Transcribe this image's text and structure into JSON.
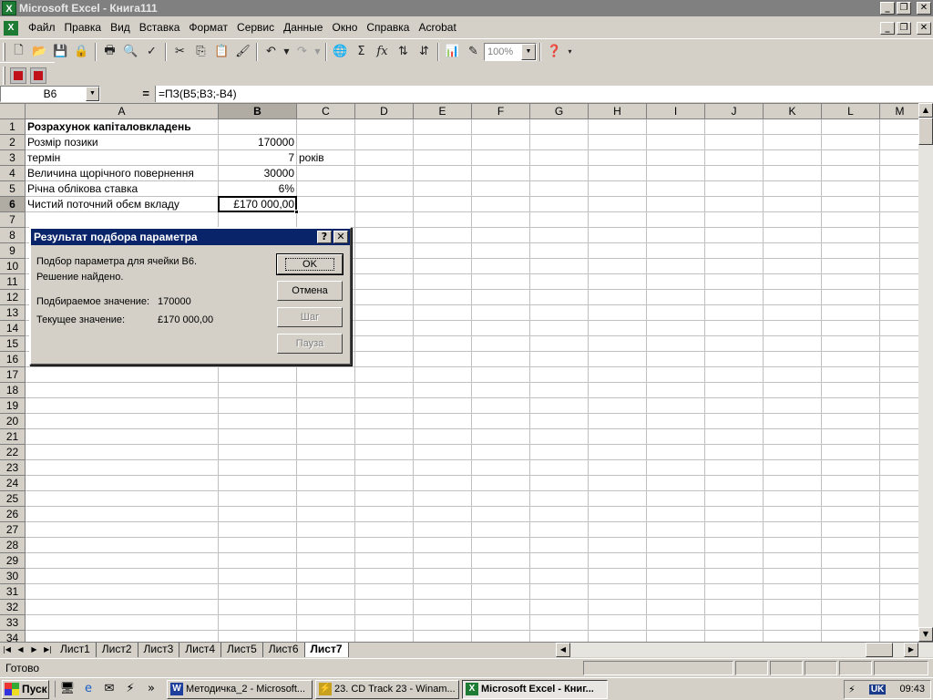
{
  "window": {
    "title": "Microsoft Excel - Книга111"
  },
  "menu": [
    "Файл",
    "Правка",
    "Вид",
    "Вставка",
    "Формат",
    "Сервис",
    "Данные",
    "Окно",
    "Справка",
    "Acrobat"
  ],
  "toolbar": {
    "zoom": "100%"
  },
  "formula_bar": {
    "name_box": "B6",
    "equals": "=",
    "formula": "=ПЗ(B5;B3;-B4)"
  },
  "columns": [
    "A",
    "B",
    "C",
    "D",
    "E",
    "F",
    "G",
    "H",
    "I",
    "J",
    "K",
    "L",
    "M"
  ],
  "rows": [
    "1",
    "2",
    "3",
    "4",
    "5",
    "6",
    "7",
    "8",
    "9",
    "10",
    "11",
    "12",
    "13",
    "14",
    "15",
    "16",
    "17",
    "18",
    "19",
    "20",
    "21",
    "22",
    "23",
    "24",
    "25",
    "26",
    "27",
    "28",
    "29",
    "30",
    "31",
    "32",
    "33",
    "34"
  ],
  "cells": {
    "a1": "Розрахунок капіталовкладень",
    "a2": "Розмір позики",
    "b2": "170000",
    "a3": "термін",
    "b3": "7",
    "c3": "років",
    "a4": "Величина щорічного повернення",
    "b4": "30000",
    "a5": "Річна облікова ставка",
    "b5": "6%",
    "a6": "Чистий поточний обєм вкладу",
    "b6": "£170 000,00"
  },
  "dialog": {
    "title": "Результат подбора параметра",
    "line1": "Подбор параметра для ячейки B6.",
    "line2": "Решение найдено.",
    "target_label": "Подбираемое значение:",
    "target_value": "170000",
    "current_label": "Текущее значение:",
    "current_value": "£170 000,00",
    "btn_ok": "OK",
    "btn_cancel": "Отмена",
    "btn_step": "Шаг",
    "btn_pause": "Пауза",
    "help": "?",
    "close": "✕"
  },
  "sheets": [
    "Лист1",
    "Лист2",
    "Лист3",
    "Лист4",
    "Лист5",
    "Лист6",
    "Лист7"
  ],
  "active_sheet": "Лист7",
  "status": {
    "text": "Готово"
  },
  "taskbar": {
    "start": "Пуск",
    "tasks": [
      {
        "label": "Методичка_2 - Microsoft...",
        "icon": "word-icon"
      },
      {
        "label": "23. CD Track 23 - Winam...",
        "icon": "winamp-icon"
      },
      {
        "label": "Microsoft Excel - Книг...",
        "icon": "excel-icon"
      }
    ],
    "lang": "UK",
    "clock": "09:43"
  }
}
